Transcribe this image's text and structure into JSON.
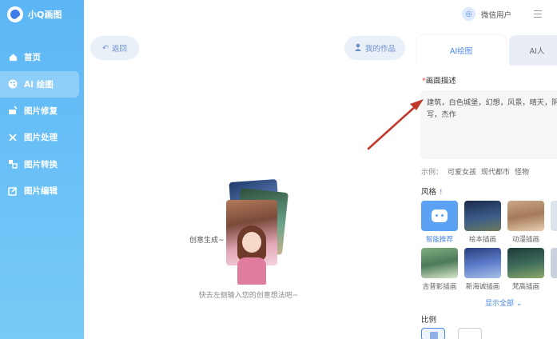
{
  "app": {
    "name": "小Q画图"
  },
  "sidebar": {
    "items": [
      {
        "label": "首页",
        "icon": "home-icon"
      },
      {
        "label": "AI 绘图",
        "icon": "palette-icon",
        "active": true
      },
      {
        "label": "图片修复",
        "icon": "wand-icon"
      },
      {
        "label": "图片处理",
        "icon": "tools-icon"
      },
      {
        "label": "图片转换",
        "icon": "convert-icon"
      },
      {
        "label": "图片编辑",
        "icon": "edit-icon"
      }
    ]
  },
  "topbar": {
    "user_label": "微信用户"
  },
  "center": {
    "back_label": "返回",
    "works_label": "我的作品",
    "bubble_text": "创意生成~",
    "hint_text": "快去左侧输入您的创意想法吧~"
  },
  "right": {
    "tabs": [
      {
        "label": "AI绘图",
        "active": true
      },
      {
        "label": "AI人"
      }
    ],
    "desc_label": "画面描述",
    "desc_required": "*",
    "desc_text": "建筑，白色城堡，幻想，风景，晴天，阴\n写，杰作",
    "examples_label": "示例：",
    "examples": [
      "可爱女孩",
      "现代都市",
      "怪物"
    ],
    "style_label": "风格",
    "style_info": "!",
    "styles_row1": [
      "智能推荐",
      "绘本插画",
      "动漫插画"
    ],
    "styles_row2": [
      "吉普影插画",
      "新海诚插画",
      "梵高插画"
    ],
    "show_all": "显示全部",
    "ratio_label": "比例"
  },
  "colors": {
    "accent": "#4a86e8",
    "sidebar_top": "#5cb6f5",
    "sidebar_bottom": "#77cbf7",
    "annotation_arrow": "#c0392b"
  }
}
